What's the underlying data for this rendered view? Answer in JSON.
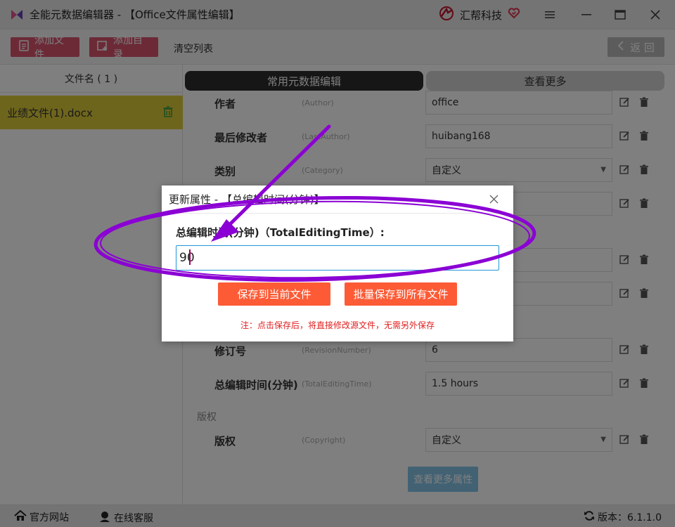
{
  "app": {
    "title": "全能元数据编辑器 - 【Office文件属性编辑】",
    "brand": "汇帮科技"
  },
  "toolbar": {
    "add_file": "添加文件",
    "add_dir": "添加目录",
    "clear_list": "清空列表",
    "back": "返 回"
  },
  "sidebar": {
    "header": "文件名 ( 1 )",
    "files": [
      "业绩文件(1).docx"
    ]
  },
  "tabs": {
    "common": "常用元数据编辑",
    "more": "查看更多"
  },
  "rows": {
    "author": {
      "label": "作者",
      "en": "(Author)",
      "value": "office"
    },
    "last_author": {
      "label": "最后修改者",
      "en": "(LastAuthor)",
      "value": "huibang168"
    },
    "category": {
      "label": "类别",
      "en": "(Category)",
      "value": "自定义"
    },
    "revision": {
      "label": "修订号",
      "en": "(RevisionNumber)",
      "value": "6"
    },
    "editing_time": {
      "label": "总编辑时间(分钟)",
      "en": "(TotalEditingTime)",
      "value": "1.5 hours"
    },
    "copyright": {
      "label": "版权",
      "en": "(Copyright)",
      "value": "自定义"
    }
  },
  "sections": {
    "copyright": "版权"
  },
  "more_button": "查看更多属性",
  "statusbar": {
    "website": "官方网站",
    "support": "在线客服",
    "version": "版本：6.1.1.0"
  },
  "modal": {
    "title": "更新属性 - 【总编辑时间(分钟)】",
    "field_label": "总编辑时间(分钟)（TotalEditingTime）:",
    "input_value": "90",
    "save_current": "保存到当前文件",
    "save_all": "批量保存到所有文件",
    "note": "注：点击保存后，将直接修改源文件，无需另外保存"
  },
  "colors": {
    "accent_pink": "#d9546f",
    "file_highlight": "#dccb3a",
    "primary_blue": "#2196d8",
    "save_orange": "#fd5b36",
    "annotation_purple": "#8b00d4"
  }
}
